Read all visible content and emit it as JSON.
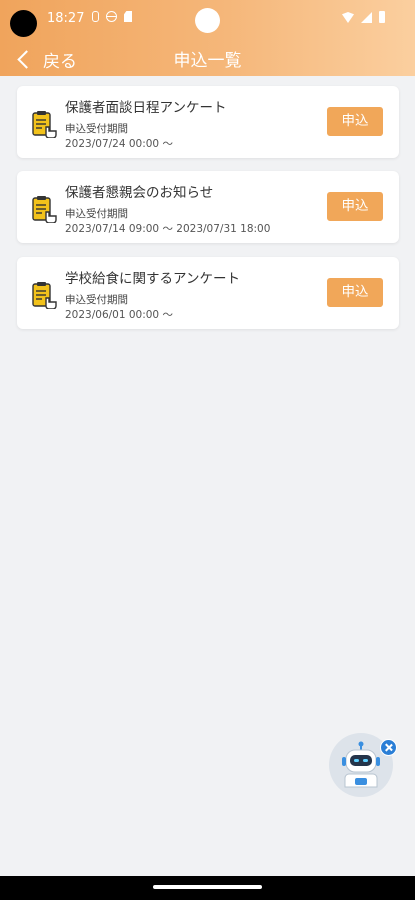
{
  "status_bar": {
    "time": "18:27"
  },
  "header": {
    "back_label": "戻る",
    "title": "申込一覧"
  },
  "applications": [
    {
      "title": "保護者面談日程アンケート",
      "period_label": "申込受付期間",
      "period": "2023/07/24 00:00 ～",
      "button_label": "申込"
    },
    {
      "title": "保護者懇親会のお知らせ",
      "period_label": "申込受付期間",
      "period": "2023/07/14 09:00 ～ 2023/07/31 18:00",
      "button_label": "申込"
    },
    {
      "title": "学校給食に関するアンケート",
      "period_label": "申込受付期間",
      "period": "2023/06/01 00:00 ～",
      "button_label": "申込"
    }
  ],
  "icons": {
    "card": "clipboard-hand-icon",
    "assistant": "robot-assistant-icon",
    "close": "close-icon"
  },
  "colors": {
    "accent": "#f1a759",
    "header_gradient_start": "#f0a45c",
    "header_gradient_end": "#fbcf9f",
    "background": "#f1f2f4",
    "close_badge": "#2a7ed6"
  }
}
